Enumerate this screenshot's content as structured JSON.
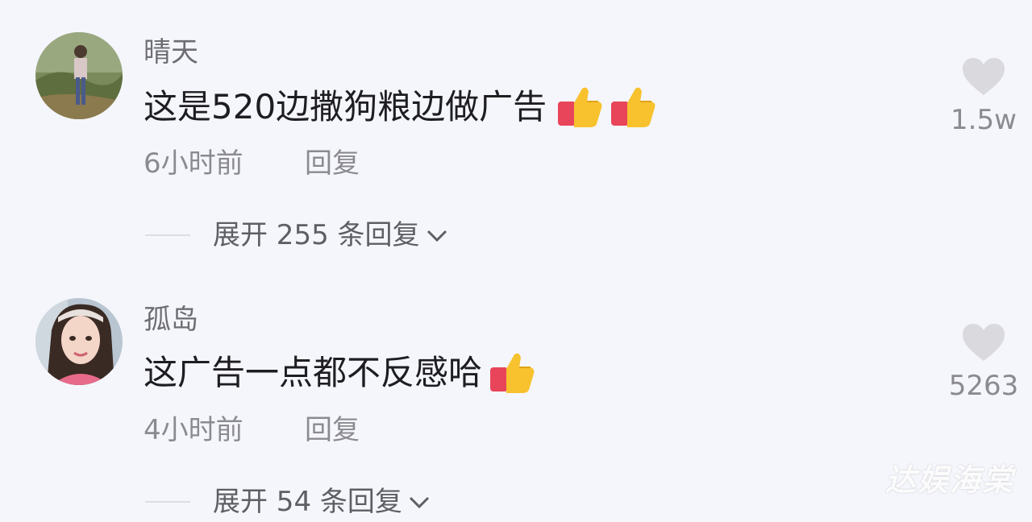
{
  "comments": [
    {
      "username": "晴天",
      "text": "这是520边撒狗粮边做广告",
      "emojis": [
        "thumbs-up",
        "thumbs-up"
      ],
      "time": "6小时前",
      "reply_label": "回复",
      "expand_label": "展开 255 条回复",
      "likes": "1.5w"
    },
    {
      "username": "孤岛",
      "text": "这广告一点都不反感哈",
      "emojis": [
        "thumbs-up"
      ],
      "time": "4小时前",
      "reply_label": "回复",
      "expand_label": "展开 54 条回复",
      "likes": "5263"
    }
  ],
  "watermark": "达娱海棠",
  "colors": {
    "background": "#f5f6fb",
    "text_primary": "#1e1e22",
    "text_secondary": "#8a8a90",
    "heart": "#d9d9de"
  },
  "icons": [
    "heart-icon",
    "thumbs-up-emoji",
    "chevron-down-icon"
  ]
}
